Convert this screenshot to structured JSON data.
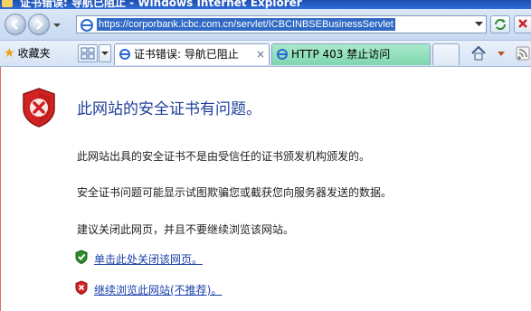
{
  "window": {
    "title": "证书错误: 导航已阻止 - Windows Internet Explorer"
  },
  "address_bar": {
    "url": "https://corporbank.icbc.com.cn/servlet/ICBCINBSEBusinessServlet"
  },
  "favorites": {
    "label": "收藏夹"
  },
  "tabs": [
    {
      "label": "证书错误: 导航已阻止",
      "close": "×",
      "active": true
    },
    {
      "label": "HTTP 403 禁止访问",
      "active": false
    },
    {
      "label": "",
      "active": false
    }
  ],
  "error_page": {
    "heading": "此网站的安全证书有问题。",
    "paragraphs": [
      "此网站出具的安全证书不是由受信任的证书颁发机构颁发的。",
      "安全证书问题可能显示试图欺骗您或截获您向服务器发送的数据。",
      "建议关闭此网页，并且不要继续浏览该网站。"
    ],
    "options": [
      {
        "label": "单击此处关闭该网页。",
        "icon": "green-shield-check-icon"
      },
      {
        "label": "继续浏览此网站(不推荐)。",
        "icon": "red-shield-x-icon"
      }
    ]
  },
  "colors": {
    "heading": "#1f3f9a",
    "link": "#1a3fa8",
    "shield_red": "#d32222",
    "shield_green": "#2e8b2e",
    "tab_active": "#ffffff",
    "tab_green": "#7fd6ae",
    "url_highlight": "#316ac5"
  }
}
